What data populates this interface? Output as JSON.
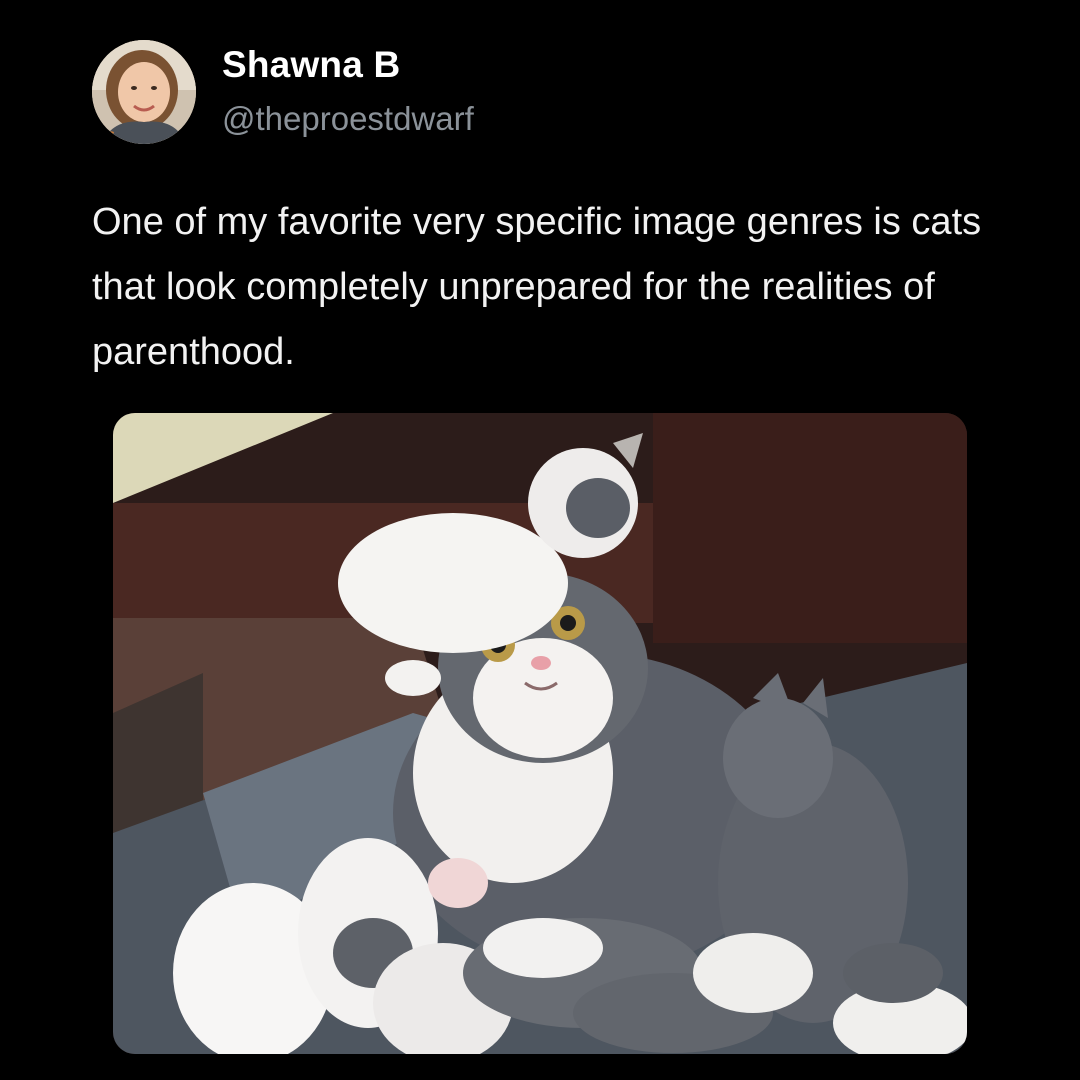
{
  "tweet": {
    "author": {
      "display_name": "Shawna B",
      "handle": "@theproestdwarf"
    },
    "text": "One of my favorite very specific image genres is cats that look completely unprepared for the realities of parenthood."
  },
  "icons": {
    "avatar": "user-photo",
    "media": "cat-photo"
  },
  "colors": {
    "background": "#000000",
    "text": "#ffffff",
    "handle": "#8b9299"
  }
}
